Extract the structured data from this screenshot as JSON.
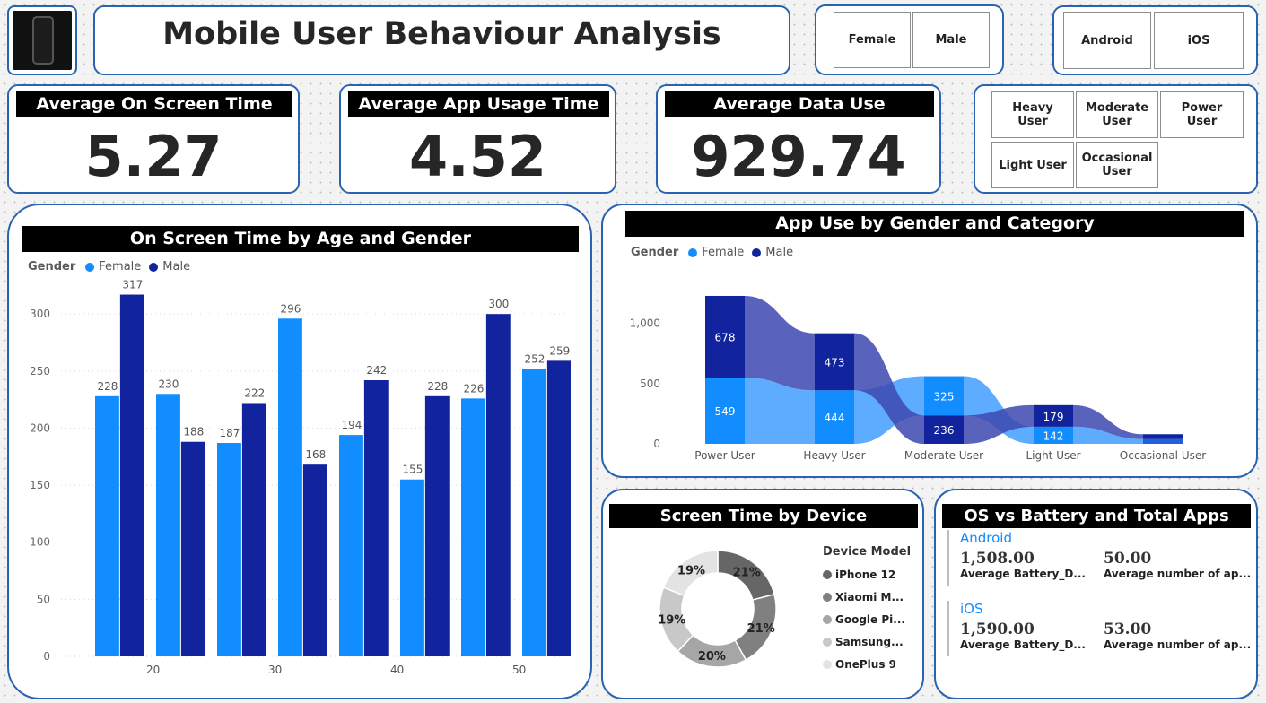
{
  "header": {
    "title": "Mobile User Behaviour Analysis",
    "phone_icon": "smartphone-icon"
  },
  "slicers": {
    "gender": [
      "Female",
      "Male"
    ],
    "os": [
      "Android",
      "iOS"
    ],
    "category_row1": [
      "Heavy User",
      "Moderate User",
      "Power User"
    ],
    "category_row2": [
      "Light User",
      "Occasional User"
    ]
  },
  "kpis": {
    "screen_time": {
      "label": "Average On Screen Time",
      "value": "5.27"
    },
    "app_usage": {
      "label": "Average App Usage Time",
      "value": "4.52"
    },
    "data_use": {
      "label": "Average Data Use",
      "value": "929.74"
    }
  },
  "colors": {
    "female": "#118dff",
    "male": "#12239e",
    "accent": "#2a64b0"
  },
  "chart_data": [
    {
      "id": "age_gender",
      "type": "bar",
      "title": "On Screen Time by Age and Gender",
      "legend_title": "Gender",
      "categories": [
        "",
        "",
        "",
        "",
        "",
        "",
        "",
        ""
      ],
      "x_tick_labels": [
        "20",
        "30",
        "40",
        "50"
      ],
      "series": [
        {
          "name": "Female",
          "values": [
            228,
            230,
            187,
            296,
            194,
            155,
            226,
            252
          ]
        },
        {
          "name": "Male",
          "values": [
            317,
            188,
            222,
            168,
            242,
            228,
            300,
            259
          ]
        }
      ],
      "y_ticks": [
        0,
        50,
        100,
        150,
        200,
        250,
        300
      ],
      "ylim": [
        0,
        330
      ],
      "legend": "top-left"
    },
    {
      "id": "app_use",
      "type": "area",
      "title": "App Use by Gender and Category",
      "legend_title": "Gender",
      "categories": [
        "Power User",
        "Heavy User",
        "Moderate User",
        "Light User",
        "Occasional User"
      ],
      "series": [
        {
          "name": "Female",
          "values": [
            549,
            444,
            325,
            142,
            40
          ]
        },
        {
          "name": "Male",
          "values": [
            678,
            473,
            236,
            179,
            40
          ]
        }
      ],
      "data_labels": [
        {
          "female": "549",
          "male": "678"
        },
        {
          "female": "444",
          "male": "473"
        },
        {
          "female": "325",
          "male": "236"
        },
        {
          "female": "142",
          "male": "179"
        },
        {
          "female": "",
          "male": ""
        }
      ],
      "y_ticks": [
        "0",
        "500",
        "1,000"
      ],
      "ylim": [
        0,
        1300
      ],
      "legend": "top-left"
    },
    {
      "id": "device",
      "type": "pie",
      "title": "Screen Time by Device",
      "legend_title": "Device Model",
      "labels": [
        "iPhone 12",
        "Xiaomi M...",
        "Google Pi...",
        "Samsung...",
        "OnePlus 9"
      ],
      "values": [
        21,
        21,
        20,
        19,
        19
      ],
      "slice_labels": [
        "21%",
        "21%",
        "20%",
        "19%",
        "19%"
      ],
      "colors": [
        "#666666",
        "#808080",
        "#a6a6a6",
        "#c8c8c8",
        "#e3e3e3"
      ]
    }
  ],
  "os_battery": {
    "title": "OS vs Battery and Total Apps",
    "rows": [
      {
        "os": "Android",
        "battery": "1,508.00",
        "battery_label": "Average Battery_D...",
        "apps": "50.00",
        "apps_label": "Average number of ap..."
      },
      {
        "os": "iOS",
        "battery": "1,590.00",
        "battery_label": "Average Battery_D...",
        "apps": "53.00",
        "apps_label": "Average number of ap..."
      }
    ]
  }
}
